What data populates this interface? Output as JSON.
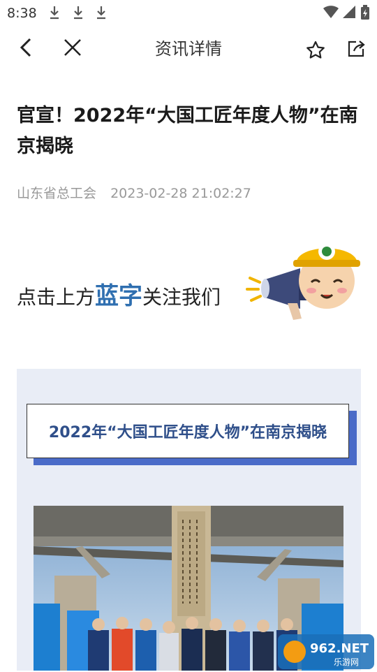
{
  "status_bar": {
    "time": "8:38"
  },
  "nav": {
    "title": "资讯详情"
  },
  "article": {
    "title": "官宣！2022年“大国工匠年度人物”在南京揭晓",
    "source": "山东省总工会",
    "datetime": "2023-02-28 21:02:27",
    "follow_prefix": "点击上方",
    "follow_highlight": "蓝字",
    "follow_suffix": "关注我们",
    "headline": "2022年“大国工匠年度人物”在南京揭晓"
  },
  "watermark": {
    "main": "962.NET",
    "sub": "乐游网"
  },
  "colors": {
    "accent_blue": "#2f6fb0",
    "card_bg": "#e9edf6",
    "headline_shadow": "#4a6bc8"
  }
}
